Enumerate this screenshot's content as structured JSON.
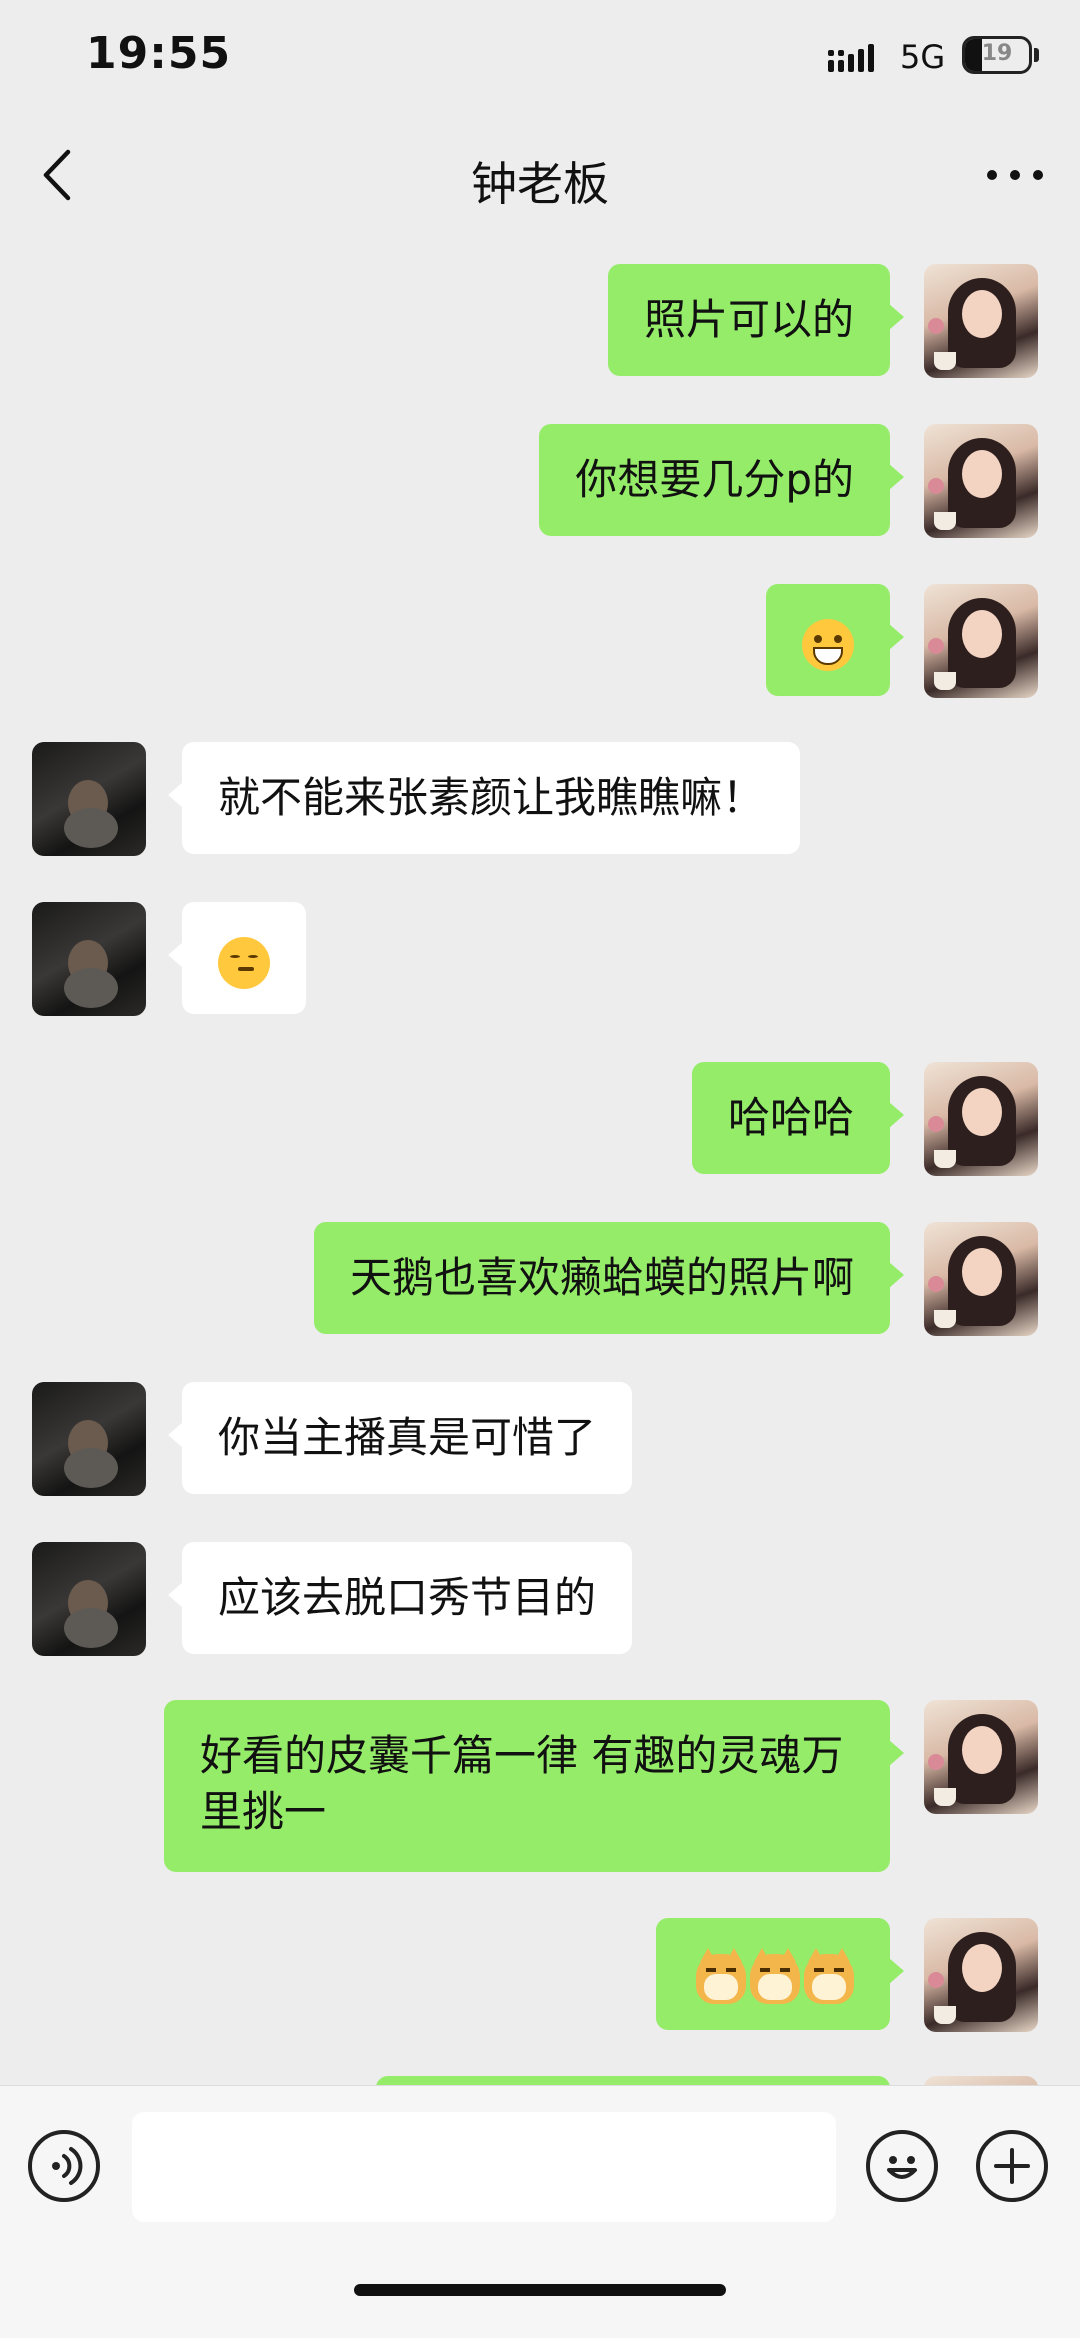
{
  "status_bar": {
    "time": "19:55",
    "network": "5G",
    "battery_level": "19",
    "signal_icon": "signal-bars-icon"
  },
  "header": {
    "title": "钟老板",
    "back_icon": "chevron-left-icon",
    "more_icon": "more-dots-icon"
  },
  "messages": [
    {
      "sender": "me",
      "type": "text",
      "text": "照片可以的"
    },
    {
      "sender": "me",
      "type": "text",
      "text": "你想要几分p的"
    },
    {
      "sender": "me",
      "type": "emoji",
      "emoji": "grin-emoji"
    },
    {
      "sender": "other",
      "type": "text",
      "text": "就不能来张素颜让我瞧瞧嘛！"
    },
    {
      "sender": "other",
      "type": "emoji",
      "emoji": "shy-smile-emoji"
    },
    {
      "sender": "me",
      "type": "text",
      "text": "哈哈哈"
    },
    {
      "sender": "me",
      "type": "text",
      "text": "天鹅也喜欢癞蛤蟆的照片啊"
    },
    {
      "sender": "other",
      "type": "text",
      "text": "你当主播真是可惜了"
    },
    {
      "sender": "other",
      "type": "text",
      "text": "应该去脱口秀节目的"
    },
    {
      "sender": "me",
      "type": "text",
      "text": "好看的皮囊千篇一律 有趣的灵魂万里挑一"
    },
    {
      "sender": "me",
      "type": "emoji",
      "emoji": "doge-emoji",
      "count": 3
    }
  ],
  "input_bar": {
    "voice_icon": "voice-icon",
    "emoji_icon": "smiley-icon",
    "plus_icon": "plus-icon",
    "placeholder": ""
  },
  "colors": {
    "background": "#ededed",
    "my_bubble": "#95ec69",
    "other_bubble": "#ffffff"
  }
}
